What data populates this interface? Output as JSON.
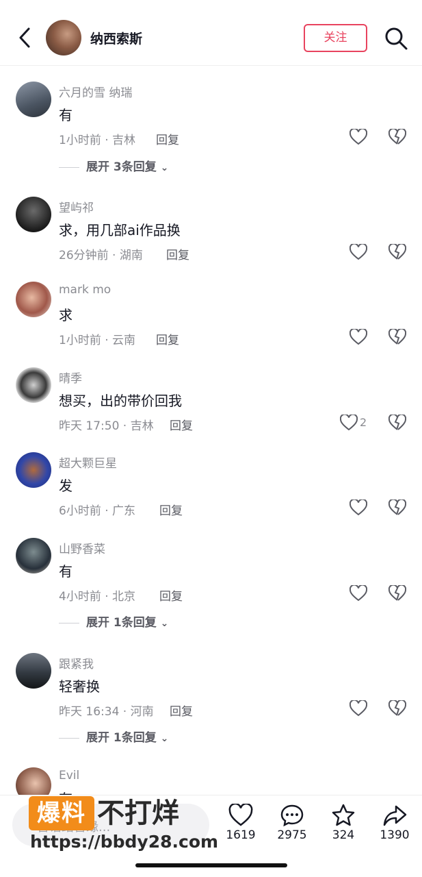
{
  "header": {
    "title": "纳西索斯",
    "follow_label": "关注"
  },
  "comments": [
    {
      "user": "六月的雪 纳瑞",
      "text": "有",
      "time": "1小时前 · 吉林",
      "reply": "回复",
      "likes": "",
      "expand": "展开 3条回复"
    },
    {
      "user": "望屿祁",
      "text": "求，用几部ai作品换",
      "time": "26分钟前 · 湖南",
      "reply": "回复",
      "likes": ""
    },
    {
      "user": "mark mo",
      "text": "求",
      "time": "1小时前 · 云南",
      "reply": "回复",
      "likes": ""
    },
    {
      "user": "晴季",
      "text": "想买，出的带价回我",
      "time": "昨天 17:50 · 吉林",
      "reply": "回复",
      "likes": "2"
    },
    {
      "user": "超大颗巨星",
      "text": "发",
      "time": "6小时前 · 广东",
      "reply": "回复",
      "likes": ""
    },
    {
      "user": "山野香菜",
      "text": "有",
      "time": "4小时前 · 北京",
      "reply": "回复",
      "likes": "",
      "expand": "展开 1条回复"
    },
    {
      "user": "跟紧我",
      "text": "轻奢换",
      "time": "昨天 16:34 · 河南",
      "reply": "回复",
      "likes": "",
      "expand": "展开 1条回复"
    },
    {
      "user": "Evil",
      "text": "有",
      "time": "",
      "reply": "",
      "likes": ""
    }
  ],
  "bottom": {
    "input_placeholder": "善语结善缘...",
    "likes": "1619",
    "comments": "2975",
    "favorites": "324",
    "shares": "1390"
  },
  "watermark": {
    "badge": "爆料",
    "slogan": "不打烊",
    "url": "https://bbdy28.com"
  },
  "colors": {
    "accent": "#e8435e",
    "watermark_orange": "#f28c1a"
  },
  "icons": [
    "back-arrow-icon",
    "search-icon",
    "heart-icon",
    "broken-heart-icon",
    "chevron-down-icon",
    "comment-icon",
    "star-icon",
    "share-icon"
  ]
}
